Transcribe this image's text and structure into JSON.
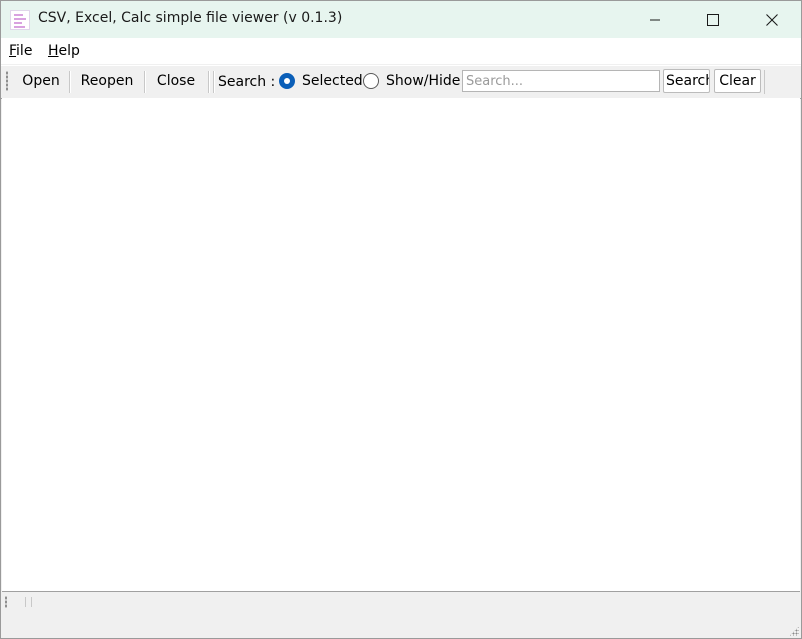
{
  "window": {
    "title": "CSV, Excel, Calc simple file viewer (v 0.1.3)",
    "app_icon": "spreadsheet-file-icon",
    "controls": {
      "minimize_icon": "minimize-icon",
      "maximize_icon": "maximize-icon",
      "close_icon": "close-icon"
    }
  },
  "menu": {
    "items": [
      {
        "mnemonic": "F",
        "rest": "ile"
      },
      {
        "mnemonic": "H",
        "rest": "elp"
      }
    ]
  },
  "toolbar": {
    "open_label": "Open",
    "reopen_label": "Reopen",
    "close_label": "Close",
    "search_label": "Search :",
    "radio_selected_label": "Selected",
    "radio_showhide_label": "Show/Hide",
    "selected_mode": "Selected",
    "search_placeholder": "Search...",
    "search_value": "",
    "search_button_label": "Search",
    "clear_button_label": "Clear"
  },
  "colors": {
    "titlebar_bg": "#e7f5ef",
    "radio_accent": "#0b5fb8",
    "chrome_bg": "#f0f0f0"
  }
}
